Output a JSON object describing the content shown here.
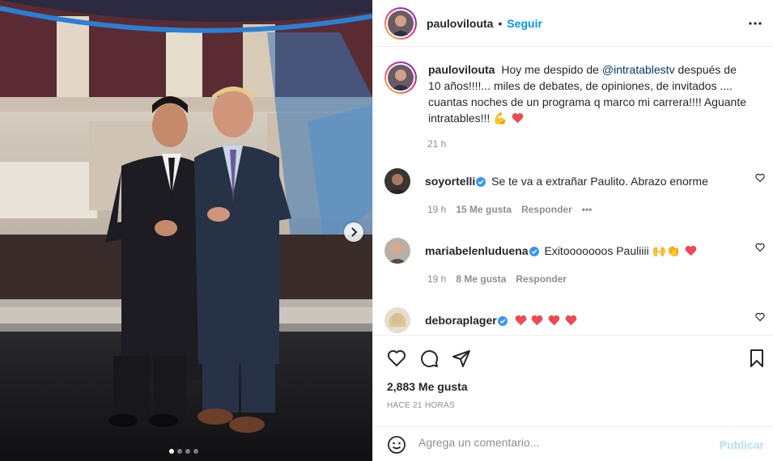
{
  "post": {
    "author": "paulovilouta",
    "separator": "•",
    "follow_label": "Seguir",
    "more_icon": "more-horizontal-icon"
  },
  "caption": {
    "username": "paulovilouta",
    "text_before": "Hoy me despido de ",
    "mention": "@intratablestv",
    "text_after": " después de 10 años!!!!... miles de debates, de opiniones, de invitados .... cuantas noches de un programa q marco mi carrera!!!! Aguante intratables!!! 💪",
    "time": "21 h"
  },
  "comments": [
    {
      "username": "soyortelli",
      "text": "Se te va a extrañar Paulito. Abrazo enorme",
      "time": "19 h",
      "likes": "15 Me gusta",
      "reply": "Responder",
      "more": "•••",
      "hearts": 0
    },
    {
      "username": "mariabelenluduena",
      "text": "Exitooooooos Pauliiii 🙌👏",
      "time": "19 h",
      "likes": "8 Me gusta",
      "reply": "Responder",
      "hearts": 1
    },
    {
      "username": "deboraplager",
      "text": "",
      "hearts": 4
    }
  ],
  "likes_count": "2,883 Me gusta",
  "posted_ago": "HACE 21 HORAS",
  "comment_box": {
    "placeholder": "Agrega un comentario...",
    "submit_label": "Publicar"
  },
  "carousel": {
    "total": 4,
    "active": 1
  },
  "colors": {
    "link": "#0095f6",
    "mention": "#00376b",
    "heart": "#ed4956",
    "muted": "#8e8e8e",
    "verified": "#3897f0"
  }
}
